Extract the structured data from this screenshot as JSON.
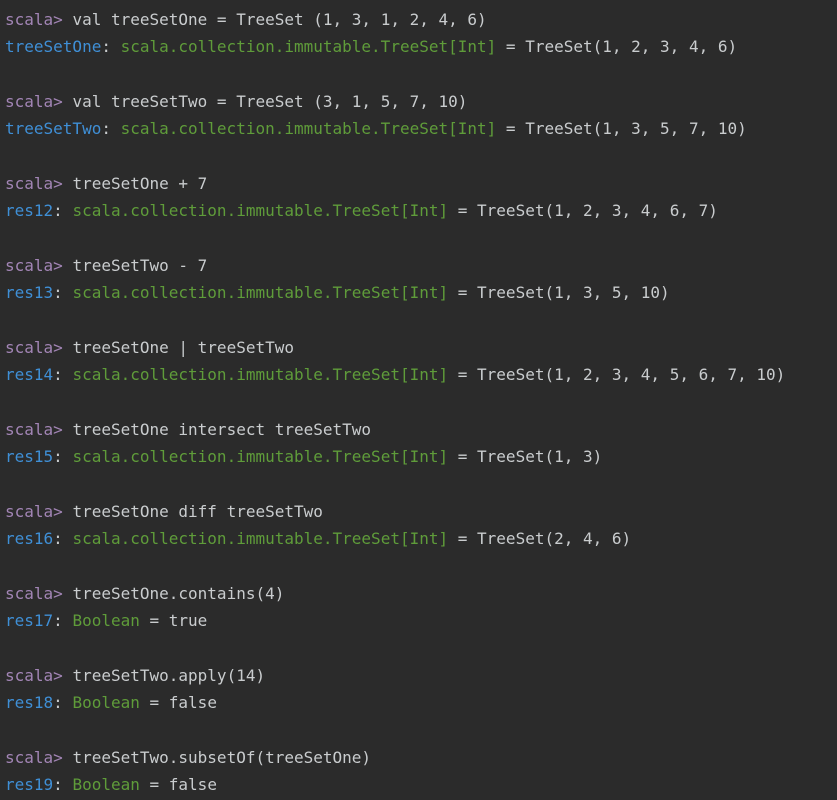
{
  "console": {
    "prompt": "scala>",
    "entries": [
      {
        "command": "val treeSetOne = TreeSet (1, 3, 1, 2, 4, 6)",
        "result_name": "treeSetOne",
        "result_type": "scala.collection.immutable.TreeSet[Int]",
        "result_value": "TreeSet(1, 2, 3, 4, 6)"
      },
      {
        "command": "val treeSetTwo = TreeSet (3, 1, 5, 7, 10)",
        "result_name": "treeSetTwo",
        "result_type": "scala.collection.immutable.TreeSet[Int]",
        "result_value": "TreeSet(1, 3, 5, 7, 10)"
      },
      {
        "command": "treeSetOne + 7",
        "result_name": "res12",
        "result_type": "scala.collection.immutable.TreeSet[Int]",
        "result_value": "TreeSet(1, 2, 3, 4, 6, 7)"
      },
      {
        "command": "treeSetTwo - 7",
        "result_name": "res13",
        "result_type": "scala.collection.immutable.TreeSet[Int]",
        "result_value": "TreeSet(1, 3, 5, 10)"
      },
      {
        "command": "treeSetOne | treeSetTwo",
        "result_name": "res14",
        "result_type": "scala.collection.immutable.TreeSet[Int]",
        "result_value": "TreeSet(1, 2, 3, 4, 5, 6, 7, 10)"
      },
      {
        "command": "treeSetOne intersect treeSetTwo",
        "result_name": "res15",
        "result_type": "scala.collection.immutable.TreeSet[Int]",
        "result_value": "TreeSet(1, 3)"
      },
      {
        "command": "treeSetOne diff treeSetTwo",
        "result_name": "res16",
        "result_type": "scala.collection.immutable.TreeSet[Int]",
        "result_value": "TreeSet(2, 4, 6)"
      },
      {
        "command": "treeSetOne.contains(4)",
        "result_name": "res17",
        "result_type": "Boolean",
        "result_value": "true"
      },
      {
        "command": "treeSetTwo.apply(14)",
        "result_name": "res18",
        "result_type": "Boolean",
        "result_value": "false"
      },
      {
        "command": "treeSetTwo.subsetOf(treeSetOne)",
        "result_name": "res19",
        "result_type": "Boolean",
        "result_value": "false"
      }
    ]
  },
  "colors": {
    "background": "#2b2b2b",
    "prompt": "#a285b5",
    "text": "#c9ccce",
    "result_name": "#3f8fd6",
    "type": "#5f9c3a"
  }
}
